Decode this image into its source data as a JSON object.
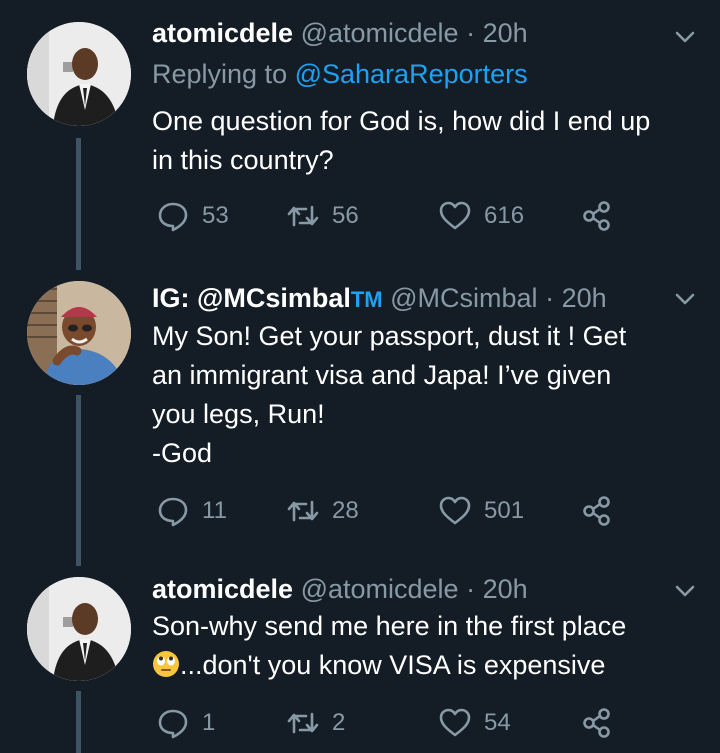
{
  "tweets": [
    {
      "name": "atomicdele",
      "handle": "@atomicdele",
      "time": "20h",
      "replying_prefix": "Replying to ",
      "replying_to": "@SaharaReporters",
      "lines": [
        "One question for God is, how did I end up",
        "in this country?"
      ],
      "replies": "53",
      "retweets": "56",
      "likes": "616"
    },
    {
      "name": "IG: @MCsimbal",
      "name_badge": "TM",
      "handle": "@MCsimbal",
      "time": "20h",
      "lines": [
        "My Son! Get your passport, dust it ! Get",
        "an immigrant visa and Japa! I’ve given",
        "you legs, Run!",
        "-God"
      ],
      "replies": "11",
      "retweets": "28",
      "likes": "501"
    },
    {
      "name": "atomicdele",
      "handle": "@atomicdele",
      "time": "20h",
      "line1": "Son-why send me here in the first place",
      "line2": "...don't you know VISA is expensive",
      "replies": "1",
      "retweets": "2",
      "likes": "54"
    }
  ],
  "separator": " · ",
  "icons": {
    "reply": "reply-icon",
    "retweet": "retweet-icon",
    "like": "heart-icon",
    "share": "share-icon",
    "menu": "chevron-down-icon",
    "emoji": "face-with-rolling-eyes-emoji"
  },
  "colors": {
    "background": "#141d26",
    "text": "#ffffff",
    "muted": "#8899a6",
    "accent": "#1da1f2",
    "thread_line": "#3d5466"
  }
}
